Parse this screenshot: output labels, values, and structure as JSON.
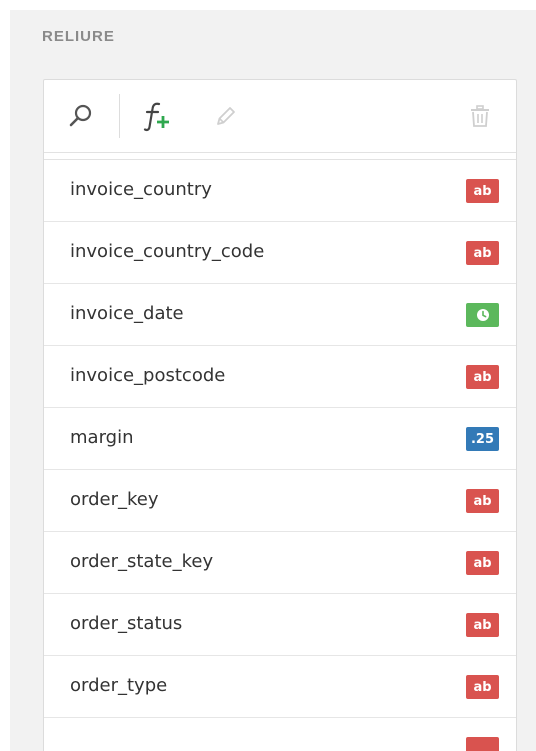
{
  "section": {
    "title": "RELIURE"
  },
  "toolbar": {
    "search_icon": "search-icon",
    "add_function_icon": "function-add-icon",
    "edit_icon": "pencil-icon",
    "delete_icon": "trash-icon"
  },
  "colors": {
    "string_badge": "#d9534f",
    "date_badge": "#5cb85c",
    "number_badge": "#337ab7",
    "add_green": "#2fa84f"
  },
  "fields": [
    {
      "name": "invoice_country",
      "type": "string",
      "badge": "ab"
    },
    {
      "name": "invoice_country_code",
      "type": "string",
      "badge": "ab"
    },
    {
      "name": "invoice_date",
      "type": "date",
      "badge": "clock-icon"
    },
    {
      "name": "invoice_postcode",
      "type": "string",
      "badge": "ab"
    },
    {
      "name": "margin",
      "type": "number",
      "badge": ".25"
    },
    {
      "name": "order_key",
      "type": "string",
      "badge": "ab"
    },
    {
      "name": "order_state_key",
      "type": "string",
      "badge": "ab"
    },
    {
      "name": "order_status",
      "type": "string",
      "badge": "ab"
    },
    {
      "name": "order_type",
      "type": "string",
      "badge": "ab"
    }
  ]
}
